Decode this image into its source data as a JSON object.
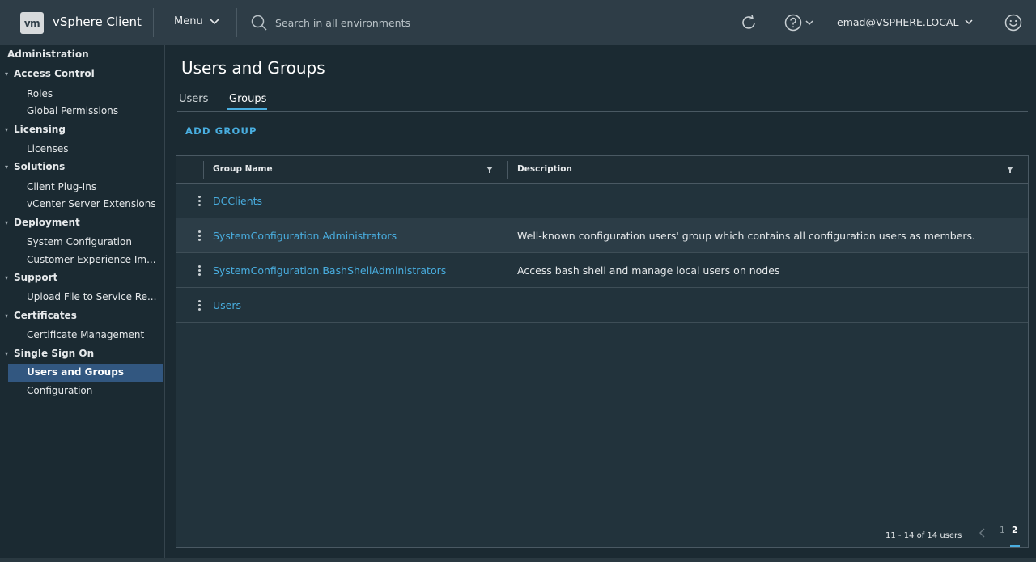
{
  "header": {
    "logo": "vm",
    "app_title": "vSphere Client",
    "menu_label": "Menu",
    "search_placeholder": "Search in all environments",
    "user": "emad@VSPHERE.LOCAL"
  },
  "sidebar": {
    "title": "Administration",
    "sections": [
      {
        "label": "Access Control",
        "items": [
          "Roles",
          "Global Permissions"
        ]
      },
      {
        "label": "Licensing",
        "items": [
          "Licenses"
        ]
      },
      {
        "label": "Solutions",
        "items": [
          "Client Plug-Ins",
          "vCenter Server Extensions"
        ]
      },
      {
        "label": "Deployment",
        "items": [
          "System Configuration",
          "Customer Experience Im..."
        ]
      },
      {
        "label": "Support",
        "items": [
          "Upload File to Service Re..."
        ]
      },
      {
        "label": "Certificates",
        "items": [
          "Certificate Management"
        ]
      },
      {
        "label": "Single Sign On",
        "items": [
          "Users and Groups",
          "Configuration"
        ]
      }
    ],
    "active_item": "Users and Groups"
  },
  "main": {
    "title": "Users and Groups",
    "tabs": [
      {
        "label": "Users"
      },
      {
        "label": "Groups"
      }
    ],
    "active_tab": "Groups",
    "add_group_label": "ADD GROUP",
    "grid": {
      "columns": [
        "Group Name",
        "Description"
      ],
      "rows": [
        {
          "name": "DCClients",
          "description": ""
        },
        {
          "name": "SystemConfiguration.Administrators",
          "description": "Well-known configuration users' group which contains all configuration users as members."
        },
        {
          "name": "SystemConfiguration.BashShellAdministrators",
          "description": "Access bash shell and manage local users on nodes"
        },
        {
          "name": "Users",
          "description": ""
        }
      ],
      "footer": {
        "count_text": "11 - 14 of 14 users",
        "pages": [
          "1",
          "2"
        ],
        "current_page": "2"
      }
    }
  },
  "colors": {
    "accent": "#49aee0",
    "header_bg": "#2e3d47",
    "body_bg": "#1b2a32",
    "active_nav": "#325780"
  }
}
